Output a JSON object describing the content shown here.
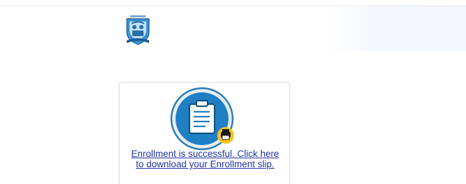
{
  "success_message": {
    "link_text": "Enrollment is successful. Click here to download your Enrollment slip."
  },
  "icons": {
    "logo": "university-crest-icon",
    "clipboard": "clipboard-list-icon",
    "printer": "printer-icon"
  },
  "colors": {
    "link": "#2233a8",
    "icon_circle": "#1f7fc3",
    "icon_ring": "#2a7db8",
    "printer_badge": "#f5c518"
  }
}
